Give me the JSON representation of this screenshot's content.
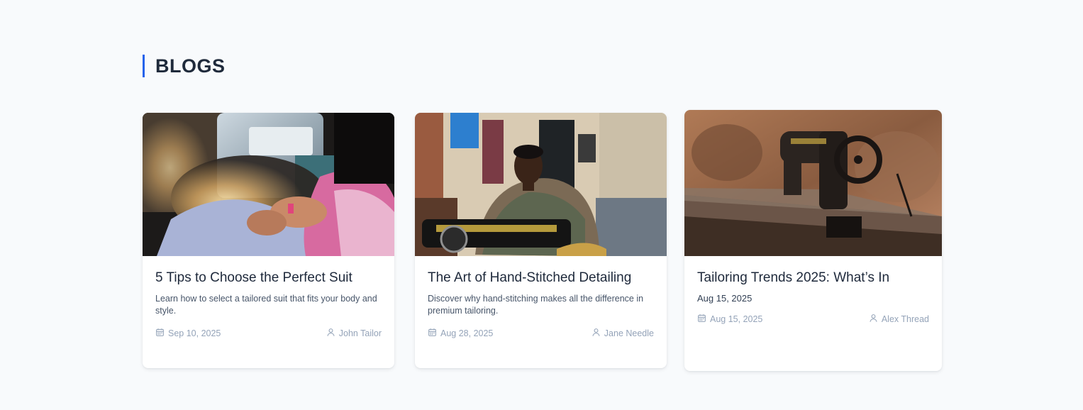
{
  "section": {
    "title": "BLOGS",
    "accent_color": "#2563eb"
  },
  "posts": [
    {
      "title": "5 Tips to Choose the Perfect Suit",
      "excerpt": "Learn how to select a tailored suit that fits your body and style.",
      "date": "Sep 10, 2025",
      "author": "John Tailor",
      "image": "photo of hands sewing fabric at a sewing machine"
    },
    {
      "title": "The Art of Hand-Stitched Detailing",
      "excerpt": "Discover why hand-stitching makes all the difference in premium tailoring.",
      "date": "Aug 28, 2025",
      "author": "Jane Needle",
      "image": "photo of a tailor working at a sewing machine in a workshop"
    },
    {
      "title": "Tailoring Trends 2025: What’s In",
      "excerpt": "Aug 15, 2025",
      "date": "Aug 15, 2025",
      "author": "Alex Thread",
      "image": "photo of a vintage sewing machine on a wooden table"
    }
  ],
  "icons": {
    "date": "calendar-icon",
    "author": "user-icon"
  }
}
